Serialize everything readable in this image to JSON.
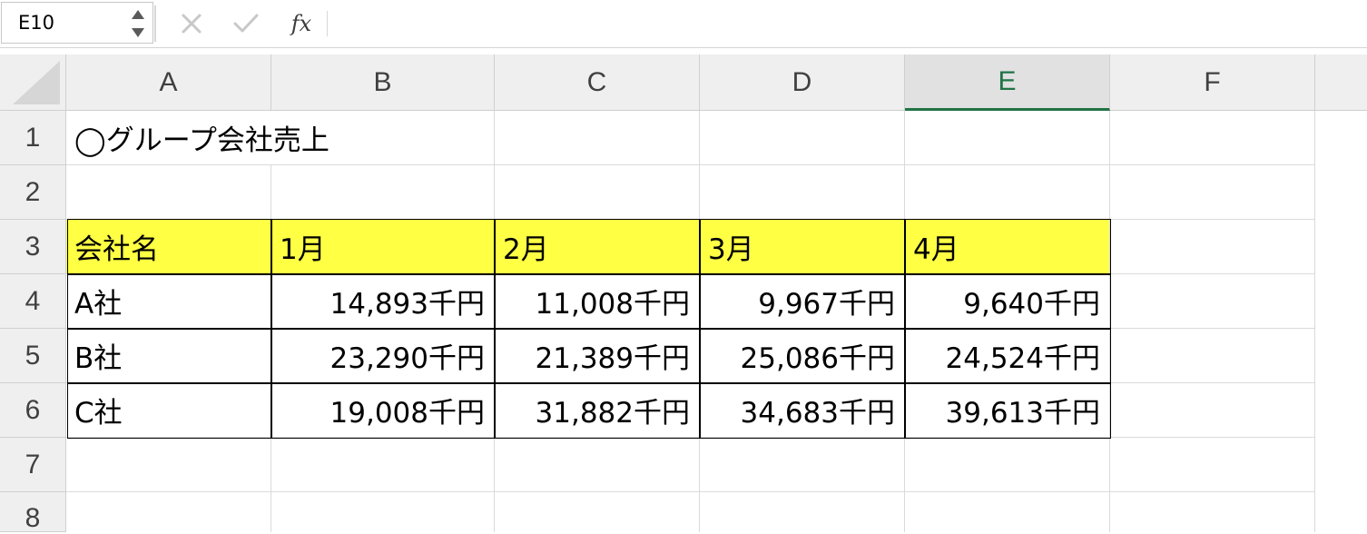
{
  "name_box": {
    "value": "E10"
  },
  "formula_bar": {
    "cancel_icon": "close-icon",
    "enter_icon": "check-icon",
    "fx_label": "fx",
    "content": ""
  },
  "columns": [
    "A",
    "B",
    "C",
    "D",
    "E",
    "F"
  ],
  "selected_column": "E",
  "rows": [
    "1",
    "2",
    "3",
    "4",
    "5",
    "6",
    "7",
    "8"
  ],
  "cells": {
    "A1": "◯グループ会社売上",
    "A3": "会社名",
    "B3": "1月",
    "C3": "2月",
    "D3": "3月",
    "E3": "4月",
    "A4": "A社",
    "B4": "14,893千円",
    "C4": "11,008千円",
    "D4": "9,967千円",
    "E4": "9,640千円",
    "A5": "B社",
    "B5": "23,290千円",
    "C5": "21,389千円",
    "D5": "25,086千円",
    "E5": "24,524千円",
    "A6": "C社",
    "B6": "19,008千円",
    "C6": "31,882千円",
    "D6": "34,683千円",
    "E6": "39,613千円"
  },
  "colors": {
    "header_fill": "#ffff44",
    "selected_header_accent": "#217346"
  }
}
